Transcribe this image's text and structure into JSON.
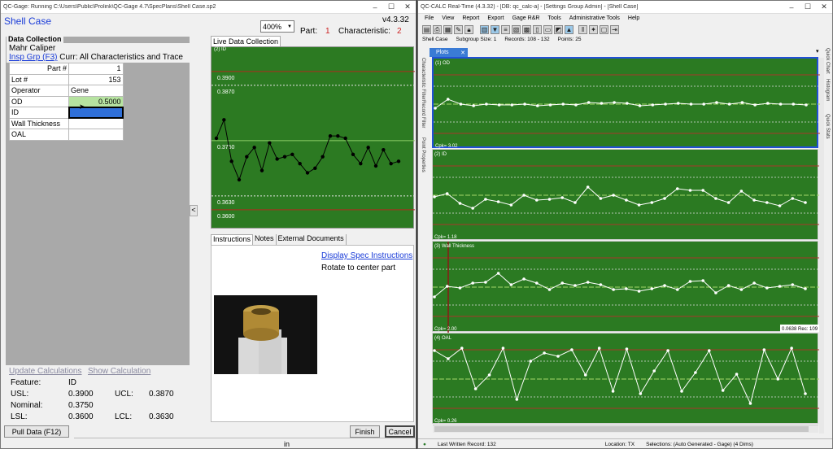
{
  "left_window": {
    "title": "QC-Gage: Running C:\\Users\\Public\\Prolink\\QC-Gage 4.7\\SpecPlans\\Shell Case.sp2",
    "app_title": "Shell Case",
    "version": "v4.3.32",
    "zoom": "400%",
    "part_label": "Part:",
    "part_value": "1",
    "characteristic_label": "Characteristic:",
    "characteristic_value": "2",
    "data_collection_label": "Data Collection",
    "gage_name": "Mahr Caliper",
    "insp_grp_link": "Insp Grp (F3)",
    "curr_text": "Curr: All Characteristics and Trace",
    "rows": [
      {
        "label": "Part #",
        "value": "1"
      },
      {
        "label": "Lot #",
        "value": "153"
      },
      {
        "label": "Operator",
        "value": "Gene"
      },
      {
        "label": "OD",
        "value": "0.5000"
      },
      {
        "label": "ID",
        "value": ""
      },
      {
        "label": "Wall Thickness",
        "value": ""
      },
      {
        "label": "OAL",
        "value": ""
      }
    ],
    "update_calc": "Update Calculations",
    "show_calc": "Show Calculation",
    "feature_label": "Feature:",
    "feature_value": "ID",
    "usl_label": "USL:",
    "usl_value": "0.3900",
    "ucl_label": "UCL:",
    "ucl_value": "0.3870",
    "nominal_label": "Nominal:",
    "nominal_value": "0.3750",
    "lsl_label": "LSL:",
    "lsl_value": "0.3600",
    "lcl_label": "LCL:",
    "lcl_value": "0.3630",
    "pull_data": "Pull Data (F12)",
    "status_in": "in",
    "finish": "Finish",
    "cancel": "Cancel",
    "collapse_arrow": "<",
    "live_tab": "Live Data Collection",
    "live_plot": {
      "label": "(2) ID",
      "usl": "0.3900",
      "ucl": "0.3870",
      "nominal": "0.3750",
      "lcl": "0.3630",
      "lsl": "0.3600"
    },
    "tabs": [
      "Instructions",
      "Notes",
      "External Documents"
    ],
    "display_spec": "Display Spec Instructions",
    "instruction_text": "Rotate to center part"
  },
  "right_window": {
    "title": "QC-CALC Real-Time (4.3.32) - [DB: qc_calc-a] - [Settings Group Admin] - [Shell Case]",
    "menu": [
      "File",
      "View",
      "Report",
      "Export",
      "Gage R&R",
      "Tools",
      "Administrative Tools",
      "Help"
    ],
    "info": {
      "part": "Shell Case",
      "subgroup": "Subgroup Size: 1",
      "records": "Records: 108 - 132",
      "points": "Points: 25"
    },
    "plots_tab": "Plots",
    "left_side_tabs": [
      "Characteristic Filter",
      "Record Filter",
      "Point Properties"
    ],
    "right_side_tabs": [
      "Quick Chart",
      "Histogram",
      "Quick Stats"
    ],
    "plots": [
      {
        "label": "(1) OD",
        "cpk": "Cpk= 3.02",
        "extra": ""
      },
      {
        "label": "(2) ID",
        "cpk": "Cpk= 1.18",
        "extra": ""
      },
      {
        "label": "(3) Wall Thickness",
        "cpk": "Cpk= 2.00",
        "extra": "0.0638 Rec: 109"
      },
      {
        "label": "(4) OAL",
        "cpk": "Cpk= 0.26",
        "extra": ""
      }
    ],
    "status_last": "Last Written Record: 132",
    "status_location": "Location: TX",
    "status_selection": "Selections: (Auto Generated - Gage) (4 Dims)"
  },
  "chart_data": [
    {
      "type": "line",
      "title": "(2) ID",
      "y": [
        0.3755,
        0.3795,
        0.3705,
        0.3665,
        0.3715,
        0.3735,
        0.3685,
        0.3745,
        0.371,
        0.3715,
        0.372,
        0.37,
        0.368,
        0.369,
        0.3715,
        0.376,
        0.376,
        0.3755,
        0.372,
        0.37,
        0.3735,
        0.3695,
        0.373,
        0.37,
        0.3705
      ],
      "ylim": [
        0.3575,
        0.3935
      ]
    },
    {
      "type": "line",
      "title": "(1) OD",
      "y": [
        0.45,
        0.56,
        0.5,
        0.48,
        0.5,
        0.49,
        0.49,
        0.5,
        0.48,
        0.49,
        0.5,
        0.49,
        0.52,
        0.51,
        0.52,
        0.51,
        0.48,
        0.49,
        0.5,
        0.51,
        0.5,
        0.5,
        0.52,
        0.5,
        0.52,
        0.49,
        0.51,
        0.5,
        0.5,
        0.49
      ],
      "ylim": [
        0,
        1
      ]
    },
    {
      "type": "line",
      "title": "(2) ID",
      "y": [
        0.48,
        0.52,
        0.4,
        0.34,
        0.45,
        0.42,
        0.38,
        0.5,
        0.44,
        0.45,
        0.47,
        0.41,
        0.6,
        0.46,
        0.5,
        0.44,
        0.38,
        0.41,
        0.46,
        0.58,
        0.56,
        0.56,
        0.46,
        0.41,
        0.55,
        0.44,
        0.41,
        0.37,
        0.46,
        0.41
      ],
      "ylim": [
        0,
        1
      ]
    },
    {
      "type": "line",
      "title": "(3) Wall Thickness",
      "y": [
        0.38,
        0.51,
        0.49,
        0.55,
        0.56,
        0.67,
        0.53,
        0.6,
        0.55,
        0.47,
        0.55,
        0.52,
        0.56,
        0.53,
        0.47,
        0.48,
        0.45,
        0.48,
        0.52,
        0.47,
        0.57,
        0.58,
        0.43,
        0.52,
        0.47,
        0.55,
        0.49,
        0.51,
        0.53,
        0.48
      ],
      "ylim": [
        0,
        1
      ]
    },
    {
      "type": "line",
      "title": "(4) OAL",
      "y": [
        0.85,
        0.75,
        0.88,
        0.38,
        0.55,
        0.88,
        0.25,
        0.72,
        0.82,
        0.78,
        0.86,
        0.55,
        0.88,
        0.35,
        0.87,
        0.32,
        0.6,
        0.85,
        0.35,
        0.58,
        0.85,
        0.36,
        0.56,
        0.2,
        0.86,
        0.5,
        0.88,
        0.32
      ],
      "ylim": [
        0,
        1
      ]
    }
  ]
}
